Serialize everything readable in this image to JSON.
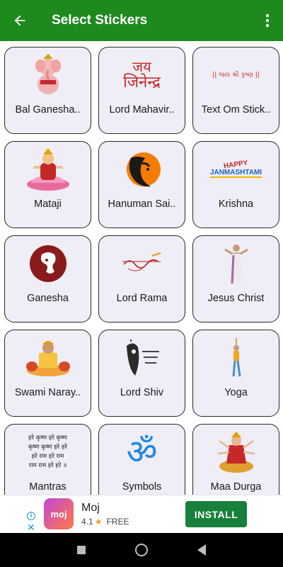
{
  "appbar": {
    "title": "Select Stickers"
  },
  "stickers": [
    {
      "label": "Bal Ganesha..",
      "icon": "ganesha-child-icon"
    },
    {
      "label": "Lord Mahavir..",
      "icon": "jai-jinendra-text-icon",
      "art_text_1": "जय",
      "art_text_2": "जिनेन्द्र"
    },
    {
      "label": "Text Om Stick..",
      "icon": "om-text-icon",
      "art_text_1": "|| જય શ્રી કૃષ્ણ ||"
    },
    {
      "label": "Mataji",
      "icon": "lakshmi-icon"
    },
    {
      "label": "Hanuman Sai..",
      "icon": "hanuman-icon"
    },
    {
      "label": "Krishna",
      "icon": "janmashtami-icon",
      "art_text_1": "HAPPY",
      "art_text_2": "JANMASHTAMI"
    },
    {
      "label": "Ganesha",
      "icon": "ganesha-logo-icon"
    },
    {
      "label": "Lord Rama",
      "icon": "rama-calligraphy-icon"
    },
    {
      "label": "Jesus Christ",
      "icon": "jesus-icon"
    },
    {
      "label": "Swami Naray..",
      "icon": "swaminarayan-icon"
    },
    {
      "label": "Lord Shiv",
      "icon": "shiva-icon"
    },
    {
      "label": "Yoga",
      "icon": "yoga-pose-icon"
    },
    {
      "label": "Mantras",
      "icon": "mantra-text-icon",
      "art_text_1": "हरे कृष्ण हरे कृष्ण",
      "art_text_2": "कृष्ण कृष्ण हरे हरे",
      "art_text_3": "हरे राम हरे राम",
      "art_text_4": "राम राम हरे हरे ॥"
    },
    {
      "label": "Symbols",
      "icon": "om-symbol-icon",
      "art_text_1": "ॐ"
    },
    {
      "label": "Maa Durga",
      "icon": "durga-icon"
    }
  ],
  "ad": {
    "app_name": "Moj",
    "logo_text": "moj",
    "rating": "4.1",
    "price": "FREE",
    "install_label": "INSTALL",
    "info_glyph": "i",
    "close_glyph": "✕"
  },
  "colors": {
    "appbar": "#1e8a1e",
    "card_bg": "#efedf5",
    "install": "#16803c"
  }
}
